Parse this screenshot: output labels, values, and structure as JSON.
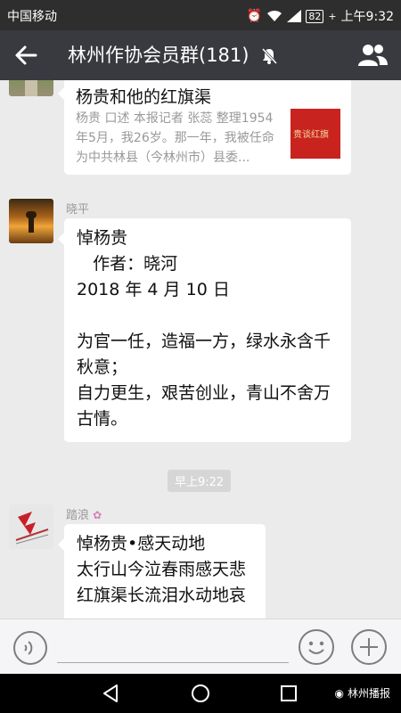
{
  "status": {
    "carrier": "中国移动",
    "battery": "82",
    "time": "上午9:32"
  },
  "header": {
    "title": "林州作协会员群(181)"
  },
  "messages": {
    "article": {
      "title": "杨贵和他的红旗渠",
      "desc": "杨贵 口述 本报记者 张蕊 整理1954年5月，我26岁。那一年，我被任命为中共林县（今林州市）县委...",
      "thumb_text": "贵谈红旗"
    },
    "msg1": {
      "sender": "晓平",
      "text": "悼杨贵\n   作者：晓河\n2018 年 4 月 10 日\n\n为官一任，造福一方，绿水永含千秋意；\n自力更生，艰苦创业，青山不舍万古情。"
    },
    "timestamp": "早上9:22",
    "msg2": {
      "sender": "踏浪",
      "text": "悼杨贵•感天动地\n太行山今泣春雨感天悲\n红旗渠长流泪水动地哀"
    }
  },
  "watermark": "林州播报",
  "colors": {
    "header_bg": "#393a3f",
    "status_bg": "#2e2e2e",
    "chat_bg": "#ebebeb",
    "input_bg": "#f5f5f7"
  }
}
